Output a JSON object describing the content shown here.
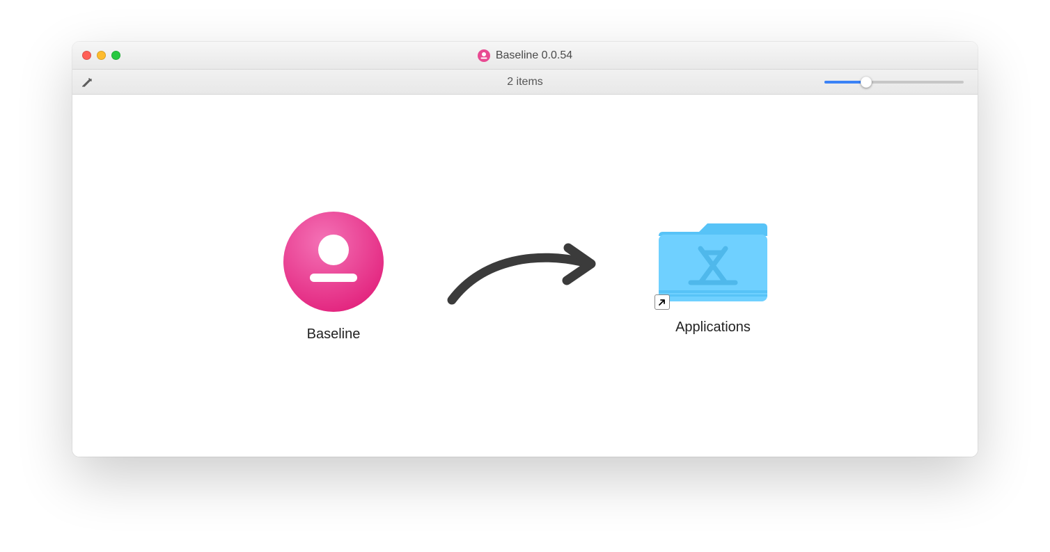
{
  "window": {
    "title": "Baseline 0.0.54",
    "app_icon_name": "baseline-app-icon"
  },
  "toolbar": {
    "item_count_label": "2 items",
    "icon_size_slider_value_pct": 30
  },
  "items": {
    "app": {
      "label": "Baseline"
    },
    "applications": {
      "label": "Applications"
    }
  },
  "colors": {
    "brand_pink": "#e84a92",
    "folder_blue": "#6fd0ff",
    "folder_blue_dark": "#57c3f7",
    "arrow": "#3b3b3b",
    "slider_accent": "#3b82f6"
  }
}
